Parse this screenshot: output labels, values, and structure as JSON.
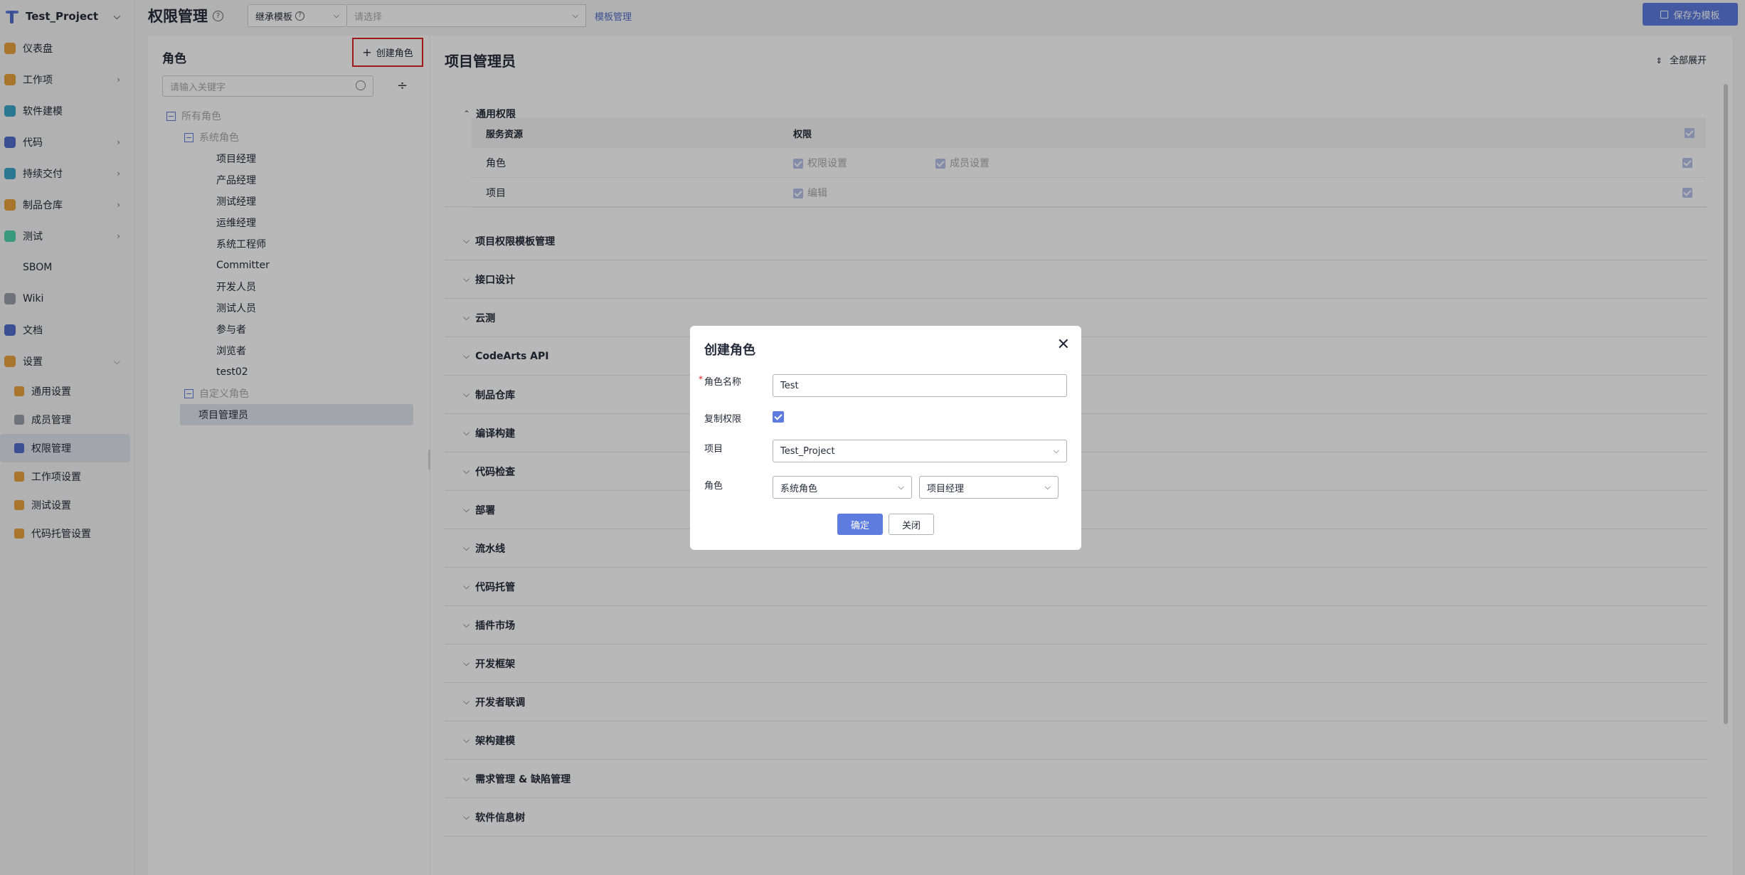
{
  "project": {
    "name": "Test_Project"
  },
  "nav": [
    {
      "label": "仪表盘",
      "color": "#e8a23c",
      "arrow": false
    },
    {
      "label": "工作项",
      "color": "#e8a23c",
      "arrow": true
    },
    {
      "label": "软件建模",
      "color": "#3aa5c8",
      "arrow": false
    },
    {
      "label": "代码",
      "color": "#526ecc",
      "arrow": true
    },
    {
      "label": "持续交付",
      "color": "#3aa5c8",
      "arrow": true
    },
    {
      "label": "制品仓库",
      "color": "#e8a23c",
      "arrow": true
    },
    {
      "label": "测试",
      "color": "#50d4ab",
      "arrow": true
    },
    {
      "label": "SBOM",
      "color": "",
      "arrow": false
    },
    {
      "label": "Wiki",
      "color": "#9aa0ab",
      "arrow": false
    },
    {
      "label": "文档",
      "color": "#526ecc",
      "arrow": false
    },
    {
      "label": "设置",
      "color": "#e8a23c",
      "arrow": true
    }
  ],
  "settings_sub": [
    {
      "label": "通用设置"
    },
    {
      "label": "成员管理"
    },
    {
      "label": "权限管理"
    },
    {
      "label": "工作项设置"
    },
    {
      "label": "测试设置"
    },
    {
      "label": "代码托管设置"
    }
  ],
  "header": {
    "title": "权限管理",
    "template_select": "继承模板",
    "pick_placeholder": "请选择",
    "template_link": "模板管理",
    "save_button": "保存为模板"
  },
  "roles_panel": {
    "title": "角色",
    "create_button": "创建角色",
    "search_placeholder": "请输入关键字",
    "all_roles": "所有角色",
    "system_roles": "系统角色",
    "system_items": [
      "项目经理",
      "产品经理",
      "测试经理",
      "运维经理",
      "系统工程师",
      "Committer",
      "开发人员",
      "测试人员",
      "参与者",
      "浏览者",
      "test02"
    ],
    "custom_roles": "自定义角色",
    "custom_items": [
      "项目管理员"
    ]
  },
  "detail": {
    "title": "项目管理员",
    "expand_all": "全部展开",
    "general_section": "通用权限",
    "table_headers": [
      "服务资源",
      "权限"
    ],
    "rows": [
      {
        "resource": "角色",
        "perms": [
          "权限设置",
          "成员设置"
        ]
      },
      {
        "resource": "项目",
        "perms": [
          "编辑"
        ]
      }
    ],
    "sections": [
      "项目权限模板管理",
      "接口设计",
      "云测",
      "CodeArts API",
      "制品仓库",
      "编译构建",
      "代码检查",
      "部署",
      "流水线",
      "代码托管",
      "插件市场",
      "开发框架",
      "开发者联调",
      "架构建模",
      "需求管理 & 缺陷管理",
      "软件信息树"
    ]
  },
  "modal": {
    "title": "创建角色",
    "name_label": "角色名称",
    "name_value": "Test",
    "copy_label": "复制权限",
    "copy_checked": true,
    "project_label": "项目",
    "project_value": "Test_Project",
    "role_label": "角色",
    "role_type_value": "系统角色",
    "role_value": "项目经理",
    "ok_button": "确定",
    "close_button": "关闭"
  }
}
